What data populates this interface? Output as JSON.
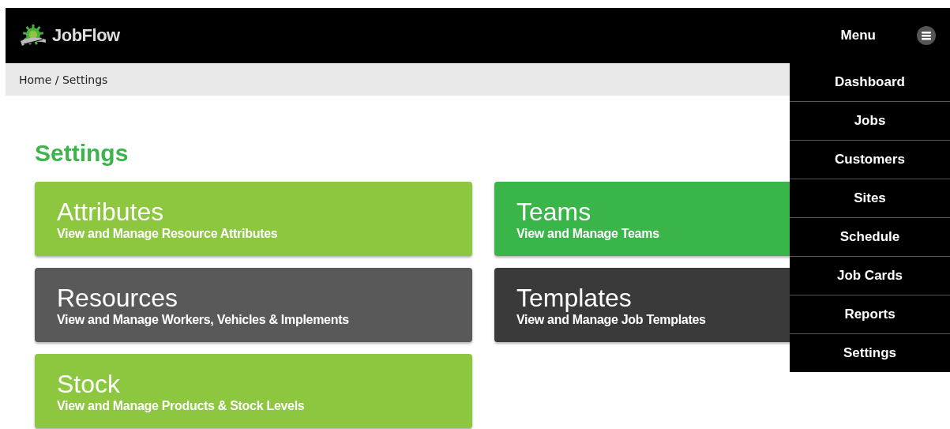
{
  "header": {
    "logo_text": "JobFlow",
    "menu_label": "Menu"
  },
  "breadcrumb": "Home / Settings",
  "page_title": "Settings",
  "cards": [
    {
      "title": "Attributes",
      "subtitle": "View and Manage Resource Attributes",
      "color": "#8dc63f"
    },
    {
      "title": "Teams",
      "subtitle": "View and Manage Teams",
      "color": "#39b54a"
    },
    {
      "title": "Resources",
      "subtitle": "View and Manage Workers, Vehicles & Implements",
      "color": "#595959"
    },
    {
      "title": "Templates",
      "subtitle": "View and Manage Job Templates",
      "color": "#3a3a3b"
    },
    {
      "title": "Stock",
      "subtitle": "View and Manage Products & Stock Levels",
      "color": "#8dc63f"
    }
  ],
  "menu_items": [
    "Dashboard",
    "Jobs",
    "Customers",
    "Sites",
    "Schedule",
    "Job Cards",
    "Reports",
    "Settings"
  ]
}
